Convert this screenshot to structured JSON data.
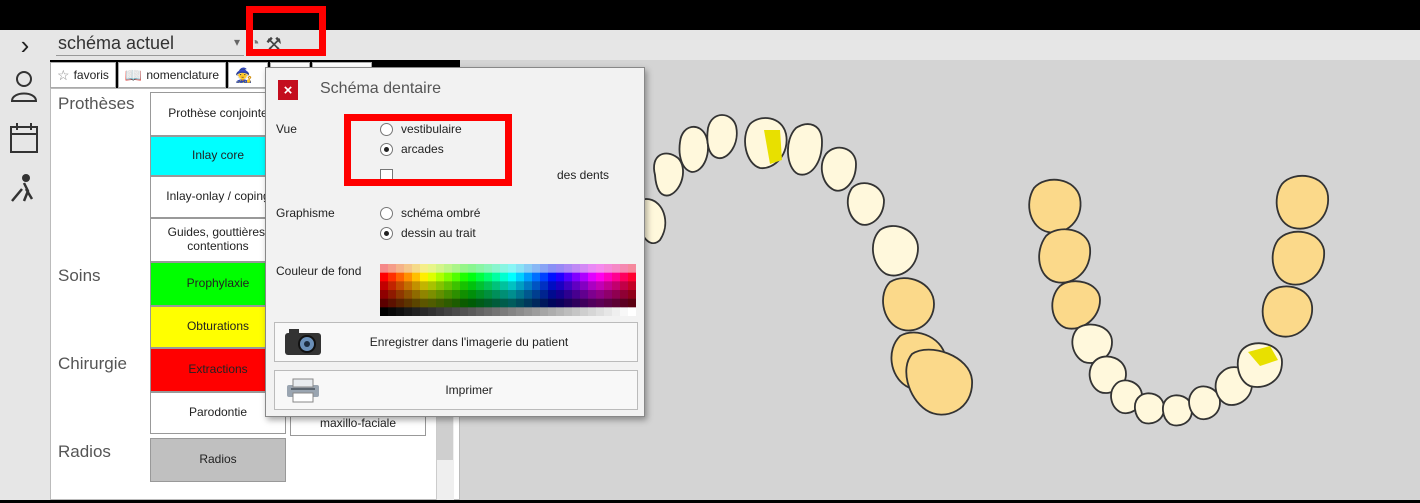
{
  "toolbar": {
    "schema_select": "schéma actuel",
    "expand_icon": "chevron-right-icon",
    "help_icon": "help-icon",
    "tools_icon": "tools-icon"
  },
  "tabs": [
    {
      "icon": "star-icon",
      "label": "favoris"
    },
    {
      "icon": "book-icon",
      "label": "nomenclature"
    },
    {
      "icon": "wizard-hat-icon",
      "label": ""
    },
    {
      "icon": "tab-icon",
      "label": ""
    },
    {
      "icon": "tab-icon",
      "label": ""
    }
  ],
  "rail": [
    "user-icon",
    "calendar-icon",
    "hiker-icon"
  ],
  "categories": {
    "protheses": "Prothèses",
    "soins": "Soins",
    "chirurgie": "Chirurgie",
    "radios": "Radios"
  },
  "category_buttons": [
    {
      "label": "Prothèse conjointe",
      "color": "#ffffff"
    },
    {
      "label": "Inlay core",
      "color": "#00ffff"
    },
    {
      "label": "Inlay-onlay / coping",
      "color": "#ffffff"
    },
    {
      "label": "Guides, gouttières, contentions",
      "color": "#ffffff"
    },
    {
      "label": "Prophylaxie",
      "color": "#00ff00"
    },
    {
      "label": "Obturations",
      "color": "#ffff00"
    },
    {
      "label": "Extractions",
      "color": "#ff0000"
    },
    {
      "label": "Parodontie",
      "color": "#ffffff"
    },
    {
      "label": "Radios",
      "color": "#c0c0c0"
    }
  ],
  "extra_button": "maxillo-faciale",
  "popup": {
    "title": "Schéma dentaire",
    "close_icon": "close-icon",
    "vue_label": "Vue",
    "vue_options": [
      {
        "label": "vestibulaire",
        "selected": false
      },
      {
        "label": "arcades",
        "selected": true
      }
    ],
    "vue_checkbox": "des dents",
    "graphisme_label": "Graphisme",
    "graphisme_options": [
      {
        "label": "schéma ombré",
        "selected": false
      },
      {
        "label": "dessin au trait",
        "selected": true
      }
    ],
    "couleur_label": "Couleur de fond",
    "save_label": "Enregistrer dans l'imagerie du patient",
    "save_icon": "camera-icon",
    "print_label": "Imprimer",
    "print_icon": "printer-icon"
  },
  "colors": {
    "highlight": "#ff0000",
    "tooth_fill": "#fff8dc",
    "molar_fill": "#fbd98a",
    "lesion": "#e8e000",
    "close_red": "#c40d1e"
  }
}
